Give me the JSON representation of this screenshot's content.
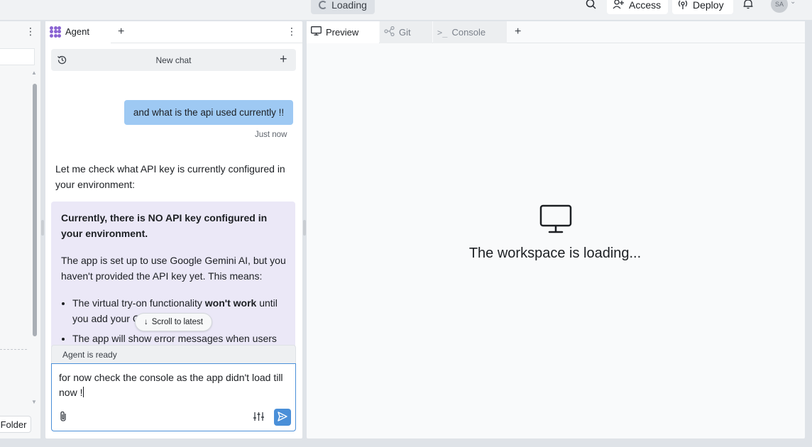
{
  "topbar": {
    "loading_label": "Loading",
    "access_label": "Access",
    "deploy_label": "Deploy",
    "avatar_initials": "SA"
  },
  "files_panel": {
    "new_folder_label": "Folder"
  },
  "agent_panel": {
    "tab_label": "Agent",
    "new_chat_label": "New chat",
    "user_message": "and what is the api used currently !!",
    "user_message_time": "Just now",
    "agent_intro": "Let me check what API key is currently configured in your environment:",
    "callout": {
      "heading": "Currently, there is NO API key configured in your environment.",
      "paragraph": "The app is set up to use Google Gemini AI, but you haven't provided the API key yet. This means:",
      "bullet1_pre": "The virtual try-on functionality ",
      "bullet1_bold": "won't work",
      "bullet1_post": " until you add your G",
      "bullet2": "The app will show error messages when users"
    },
    "scroll_latest_label": "Scroll to latest",
    "status_label": "Agent is ready",
    "input_value": "for now check the console as the app didn't load till now !"
  },
  "preview_panel": {
    "tabs": [
      {
        "label": "Preview"
      },
      {
        "label": "Git"
      },
      {
        "label": "Console"
      }
    ],
    "loading_message": "The workspace is loading..."
  },
  "colors": {
    "accent": "#4a8fd8",
    "user_bubble": "#9ec9f3",
    "callout_bg": "#ebe8f7",
    "agent_logo": "#8a63d2"
  }
}
